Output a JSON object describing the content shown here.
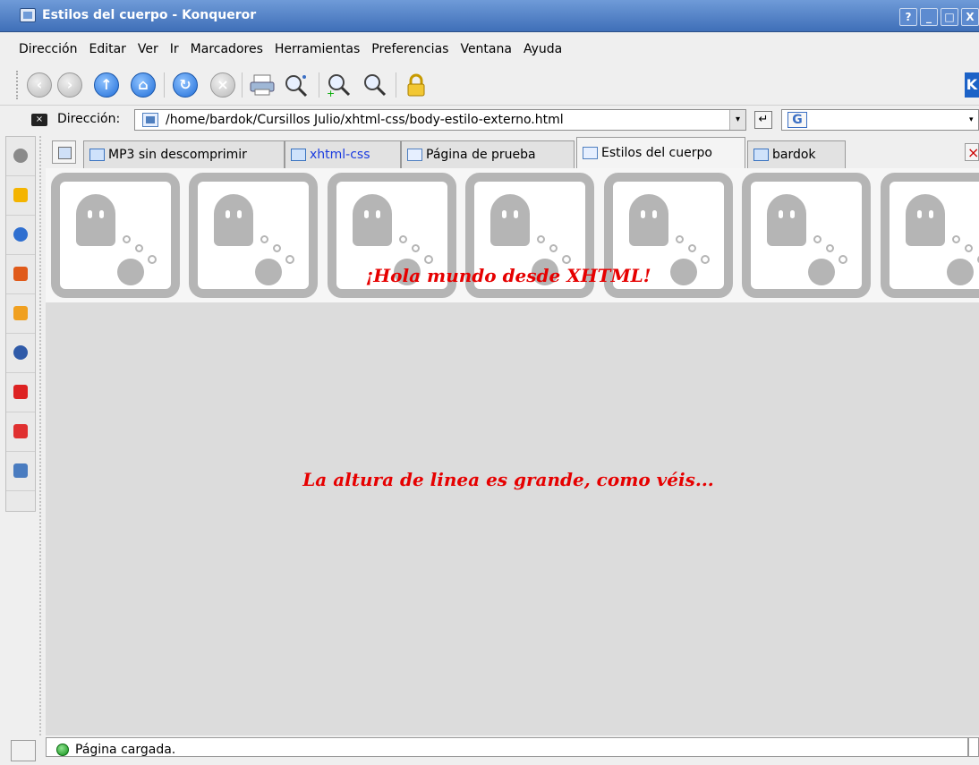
{
  "window": {
    "title": "Estilos del cuerpo - Konqueror",
    "buttons": [
      "?",
      "_",
      "□",
      "X"
    ]
  },
  "menu": [
    "Dirección",
    "Editar",
    "Ver",
    "Ir",
    "Marcadores",
    "Herramientas",
    "Preferencias",
    "Ventana",
    "Ayuda"
  ],
  "toolbar": {
    "icons": [
      "back-icon",
      "forward-icon",
      "up-icon",
      "home-icon",
      "reload-icon",
      "stop-icon",
      "print-icon",
      "find-icon",
      "zoom-in-icon",
      "zoom-out-icon",
      "security-lock-icon"
    ]
  },
  "location": {
    "label": "Dirección:",
    "url": "/home/bardok/Cursillos Julio/xhtml-css/body-estilo-externo.html",
    "search_engine": "G"
  },
  "tabs": [
    {
      "label": "MP3 sin descomprimir",
      "type": "folder",
      "active": false
    },
    {
      "label": "xhtml-css",
      "type": "folder",
      "active": false,
      "link": true
    },
    {
      "label": "Página de prueba",
      "type": "page",
      "active": false
    },
    {
      "label": "Estilos del cuerpo",
      "type": "page",
      "active": true
    },
    {
      "label": "bardok",
      "type": "folder",
      "active": false
    }
  ],
  "content": {
    "heading": "¡Hola mundo desde XHTML!",
    "paragraph": "La altura de linea es grande, como véis..."
  },
  "status": {
    "message": "Página cargada."
  },
  "colors": {
    "titlebar": "#4f80c6",
    "content_text": "#e60000",
    "content_bg": "#dcdcdc"
  }
}
